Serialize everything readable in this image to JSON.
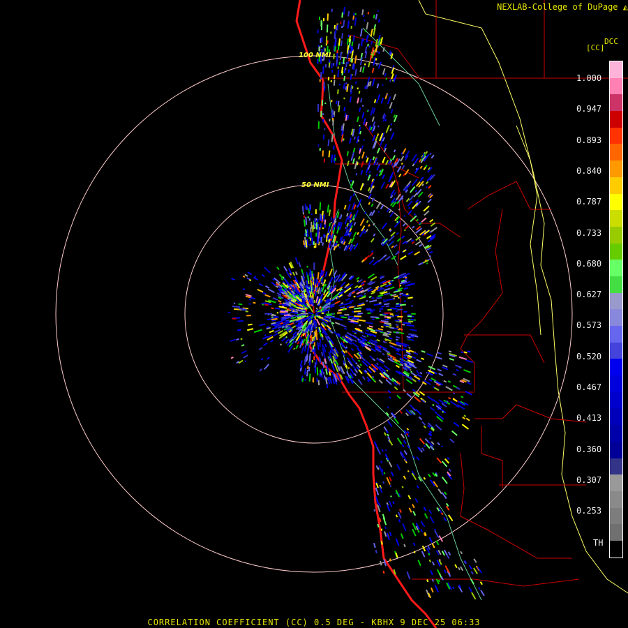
{
  "header": {
    "credit": "NEXLAB-College of DuPage"
  },
  "legend": {
    "product_code": "DCC",
    "units": "[CC]",
    "ticks": [
      "1.000",
      "0.947",
      "0.893",
      "0.840",
      "0.787",
      "0.733",
      "0.680",
      "0.627",
      "0.573",
      "0.520",
      "0.467",
      "0.413",
      "0.360",
      "0.307",
      "0.253",
      "TH"
    ],
    "colors": [
      "#ffb3d9",
      "#ff80b3",
      "#cc3366",
      "#cc0000",
      "#ff3300",
      "#ff6600",
      "#ff9900",
      "#ffcc00",
      "#ffff00",
      "#ccdd00",
      "#99cc00",
      "#66cc00",
      "#66ff66",
      "#44dd44",
      "#9999cc",
      "#8888dd",
      "#6666ee",
      "#4444dd",
      "#0000ee",
      "#0000dd",
      "#0000cc",
      "#0000bb",
      "#0000aa",
      "#000099",
      "#333388",
      "#999999",
      "#8a8a8a",
      "#7d7d7d",
      "#707070",
      "#000000"
    ]
  },
  "rings": [
    {
      "label": "50 NMI"
    },
    {
      "label": "100 NMI"
    }
  ],
  "footer": {
    "caption": "CORRELATION COEFFICIENT (CC) 0.5 DEG - KBHX 9 DEC 25 06:33"
  },
  "colors": {
    "text": "#e6e600",
    "coast": "#ff1a1a",
    "ring": "#ffcccc",
    "state_border": "#ffff66",
    "county": "#cc0000",
    "river": "#66cc99"
  }
}
